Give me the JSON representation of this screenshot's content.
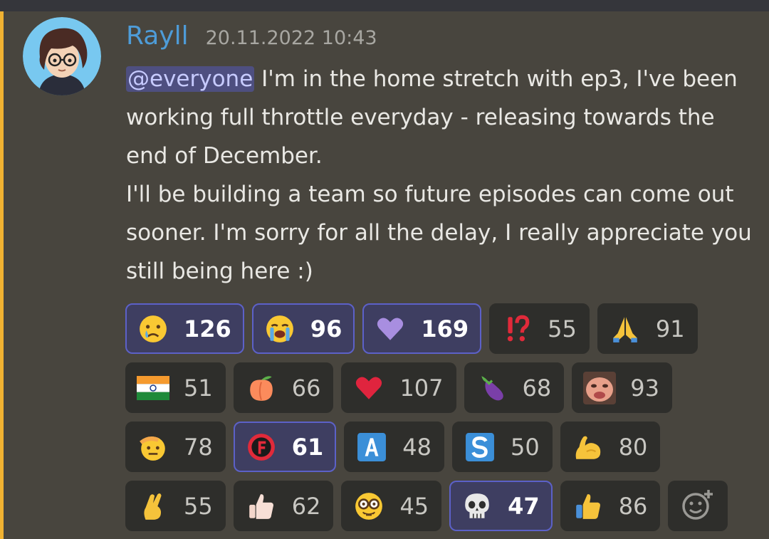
{
  "message": {
    "author": "Rayll",
    "timestamp": "20.11.2022 10:43",
    "mention": "@everyone",
    "line1": " I'm in the home stretch with ep3, I've been working full throttle everyday - releasing towards the end of December.",
    "line2": "I'll be building a team so future episodes can come out sooner. I'm sorry for all the delay, I really appreciate you still being here :)"
  },
  "colors": {
    "author": "#4e9cd8",
    "accent_bar": "#f0b232",
    "self_reaction_border": "#5c61c8"
  },
  "reactions": [
    {
      "emoji": "crying-face-icon",
      "count": "126",
      "me": true
    },
    {
      "emoji": "loudly-crying-face-icon",
      "count": "96",
      "me": true
    },
    {
      "emoji": "purple-heart-icon",
      "count": "169",
      "me": true
    },
    {
      "emoji": "exclamation-question-icon",
      "count": "55",
      "me": false
    },
    {
      "emoji": "folded-hands-icon",
      "count": "91",
      "me": false
    },
    {
      "emoji": "india-flag-icon",
      "count": "51",
      "me": false
    },
    {
      "emoji": "peach-icon",
      "count": "66",
      "me": false
    },
    {
      "emoji": "red-heart-icon",
      "count": "107",
      "me": false
    },
    {
      "emoji": "eggplant-icon",
      "count": "68",
      "me": false
    },
    {
      "emoji": "custom-face-icon",
      "count": "93",
      "me": false
    },
    {
      "emoji": "saluting-face-icon",
      "count": "78",
      "me": false
    },
    {
      "emoji": "letter-f-badge-icon",
      "count": "61",
      "me": true
    },
    {
      "emoji": "letter-a-icon",
      "count": "48",
      "me": false
    },
    {
      "emoji": "letter-s-icon",
      "count": "50",
      "me": false
    },
    {
      "emoji": "flexed-biceps-icon",
      "count": "80",
      "me": false
    },
    {
      "emoji": "crossed-fingers-icon",
      "count": "55",
      "me": false
    },
    {
      "emoji": "thumbs-up-light-icon",
      "count": "62",
      "me": false
    },
    {
      "emoji": "nerd-face-icon",
      "count": "45",
      "me": false
    },
    {
      "emoji": "skull-icon",
      "count": "47",
      "me": true
    },
    {
      "emoji": "thumbs-up-icon",
      "count": "86",
      "me": false
    }
  ]
}
